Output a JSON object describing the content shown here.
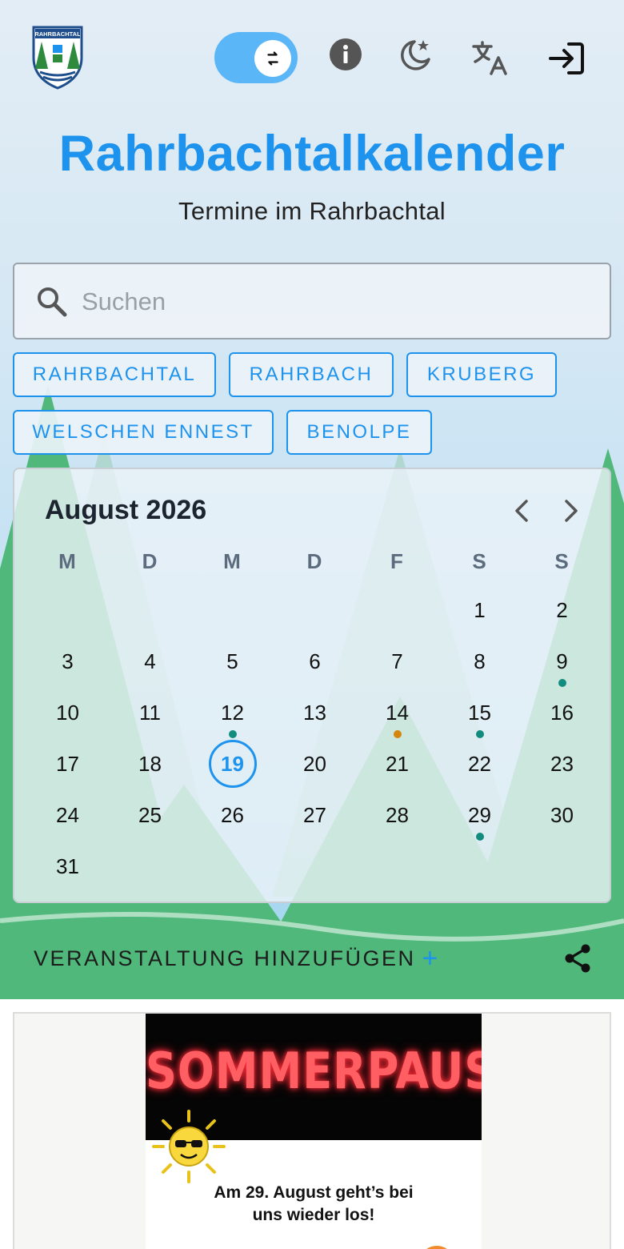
{
  "app": {
    "title": "Rahrbachtalkalender",
    "subtitle": "Termine im Rahrbachtal",
    "logo_text": "RAHRBACHTAL"
  },
  "header": {
    "icons": [
      "swap-icon",
      "info-icon",
      "dark-mode-icon",
      "translate-icon",
      "login-icon"
    ],
    "accent_color": "#1e93ee",
    "toggle_color": "#5bb6f7"
  },
  "search": {
    "placeholder": "Suchen",
    "value": ""
  },
  "filters": [
    "RAHRBACHTAL",
    "RAHRBACH",
    "KRUBERG",
    "WELSCHEN ENNEST",
    "BENOLPE"
  ],
  "calendar": {
    "month_label": "August 2026",
    "weekdays": [
      "M",
      "D",
      "M",
      "D",
      "F",
      "S",
      "S"
    ],
    "days": [
      "1",
      "2",
      "3",
      "4",
      "5",
      "6",
      "7",
      "8",
      "9",
      "10",
      "11",
      "12",
      "13",
      "14",
      "15",
      "16",
      "17",
      "18",
      "19",
      "20",
      "21",
      "22",
      "23",
      "24",
      "25",
      "26",
      "27",
      "28",
      "29",
      "30",
      "31"
    ],
    "today": "19",
    "event_dot_colors": {
      "teal": "#128c7e",
      "orange": "#d4870f"
    }
  },
  "actions": {
    "add_event_label": "VERANSTALTUNG HINZUFÜGEN",
    "add_event_plus": "+"
  },
  "event_card": {
    "headline": "SOMMERPAUSE",
    "line1": "Am 29. August geht’s bei",
    "line2": "uns wieder los!"
  }
}
